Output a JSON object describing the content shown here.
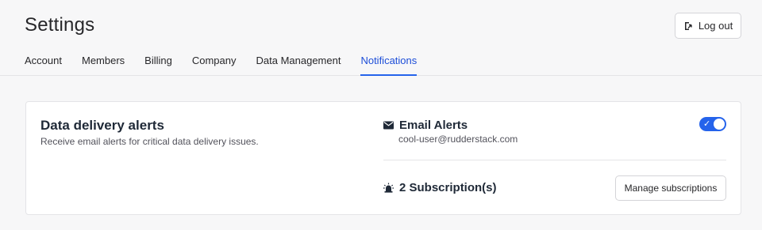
{
  "header": {
    "title": "Settings",
    "logout_label": "Log out",
    "logout_icon": "logout-arrow-icon"
  },
  "tabs": [
    {
      "label": "Account",
      "active": false
    },
    {
      "label": "Members",
      "active": false
    },
    {
      "label": "Billing",
      "active": false
    },
    {
      "label": "Company",
      "active": false
    },
    {
      "label": "Data Management",
      "active": false
    },
    {
      "label": "Notifications",
      "active": true
    }
  ],
  "alerts_card": {
    "title": "Data delivery alerts",
    "description": "Receive email alerts for critical data delivery issues.",
    "email": {
      "icon": "envelope-icon",
      "title": "Email Alerts",
      "address": "cool-user@rudderstack.com",
      "enabled": true
    },
    "subscriptions": {
      "icon": "siren-icon",
      "label": "2 Subscription(s)",
      "manage_label": "Manage subscriptions"
    }
  },
  "colors": {
    "accent": "#2563eb",
    "background": "#f7f7f8",
    "card": "#ffffff"
  }
}
